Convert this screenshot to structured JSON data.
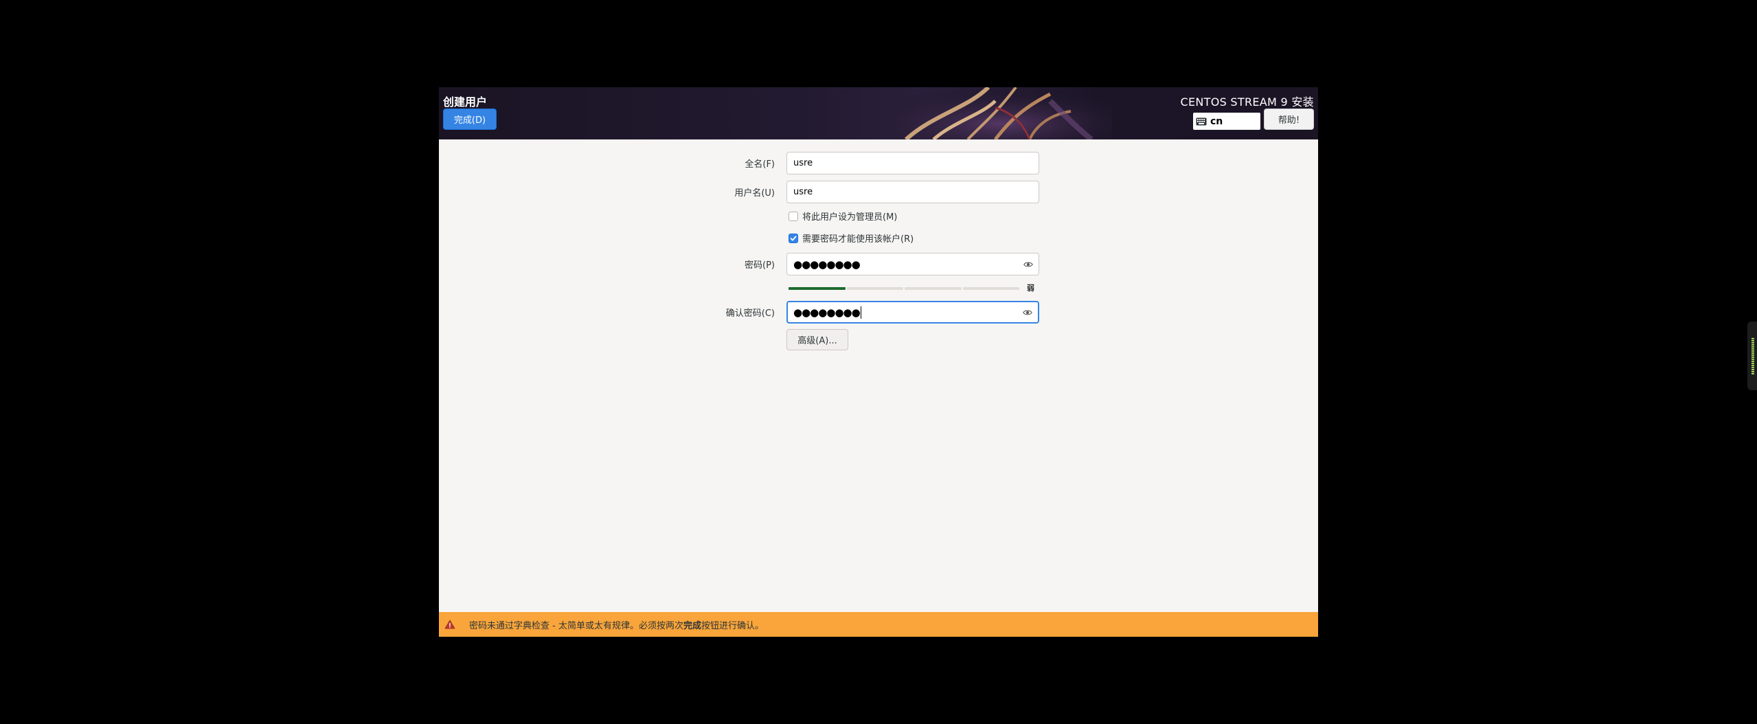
{
  "header": {
    "page_title": "创建用户",
    "done_label": "完成(D)",
    "product_title": "CENTOS STREAM 9 安装",
    "keyboard_layout": "cn",
    "help_label": "帮助!"
  },
  "form": {
    "fullname_label": "全名(F)",
    "fullname_value": "usre",
    "username_label": "用户名(U)",
    "username_value": "usre",
    "admin_checkbox_label": "将此用户设为管理员(M)",
    "admin_checked": false,
    "require_password_label": "需要密码才能使用该帐户(R)",
    "require_password_checked": true,
    "password_label": "密码(P)",
    "password_value": "●●●●●●●●",
    "strength_label": "弱",
    "strength_level": 0.25,
    "confirm_label": "确认密码(C)",
    "confirm_value": "●●●●●●●●",
    "advanced_label": "高级(A)..."
  },
  "warning": {
    "text_before": "密码未通过字典检查 - 太简单或太有规律。必须按两次",
    "text_bold": "完成",
    "text_after": "按钮进行确认。"
  },
  "icons": {
    "keyboard": "keyboard-icon",
    "eye": "eye-icon",
    "warning": "warning-icon",
    "check": "checkmark-icon"
  },
  "colors": {
    "accent": "#3584e4",
    "warning_bg": "#f9a53b",
    "strength_fill": "#1e6b2f",
    "header_bg": "#1a1424"
  }
}
